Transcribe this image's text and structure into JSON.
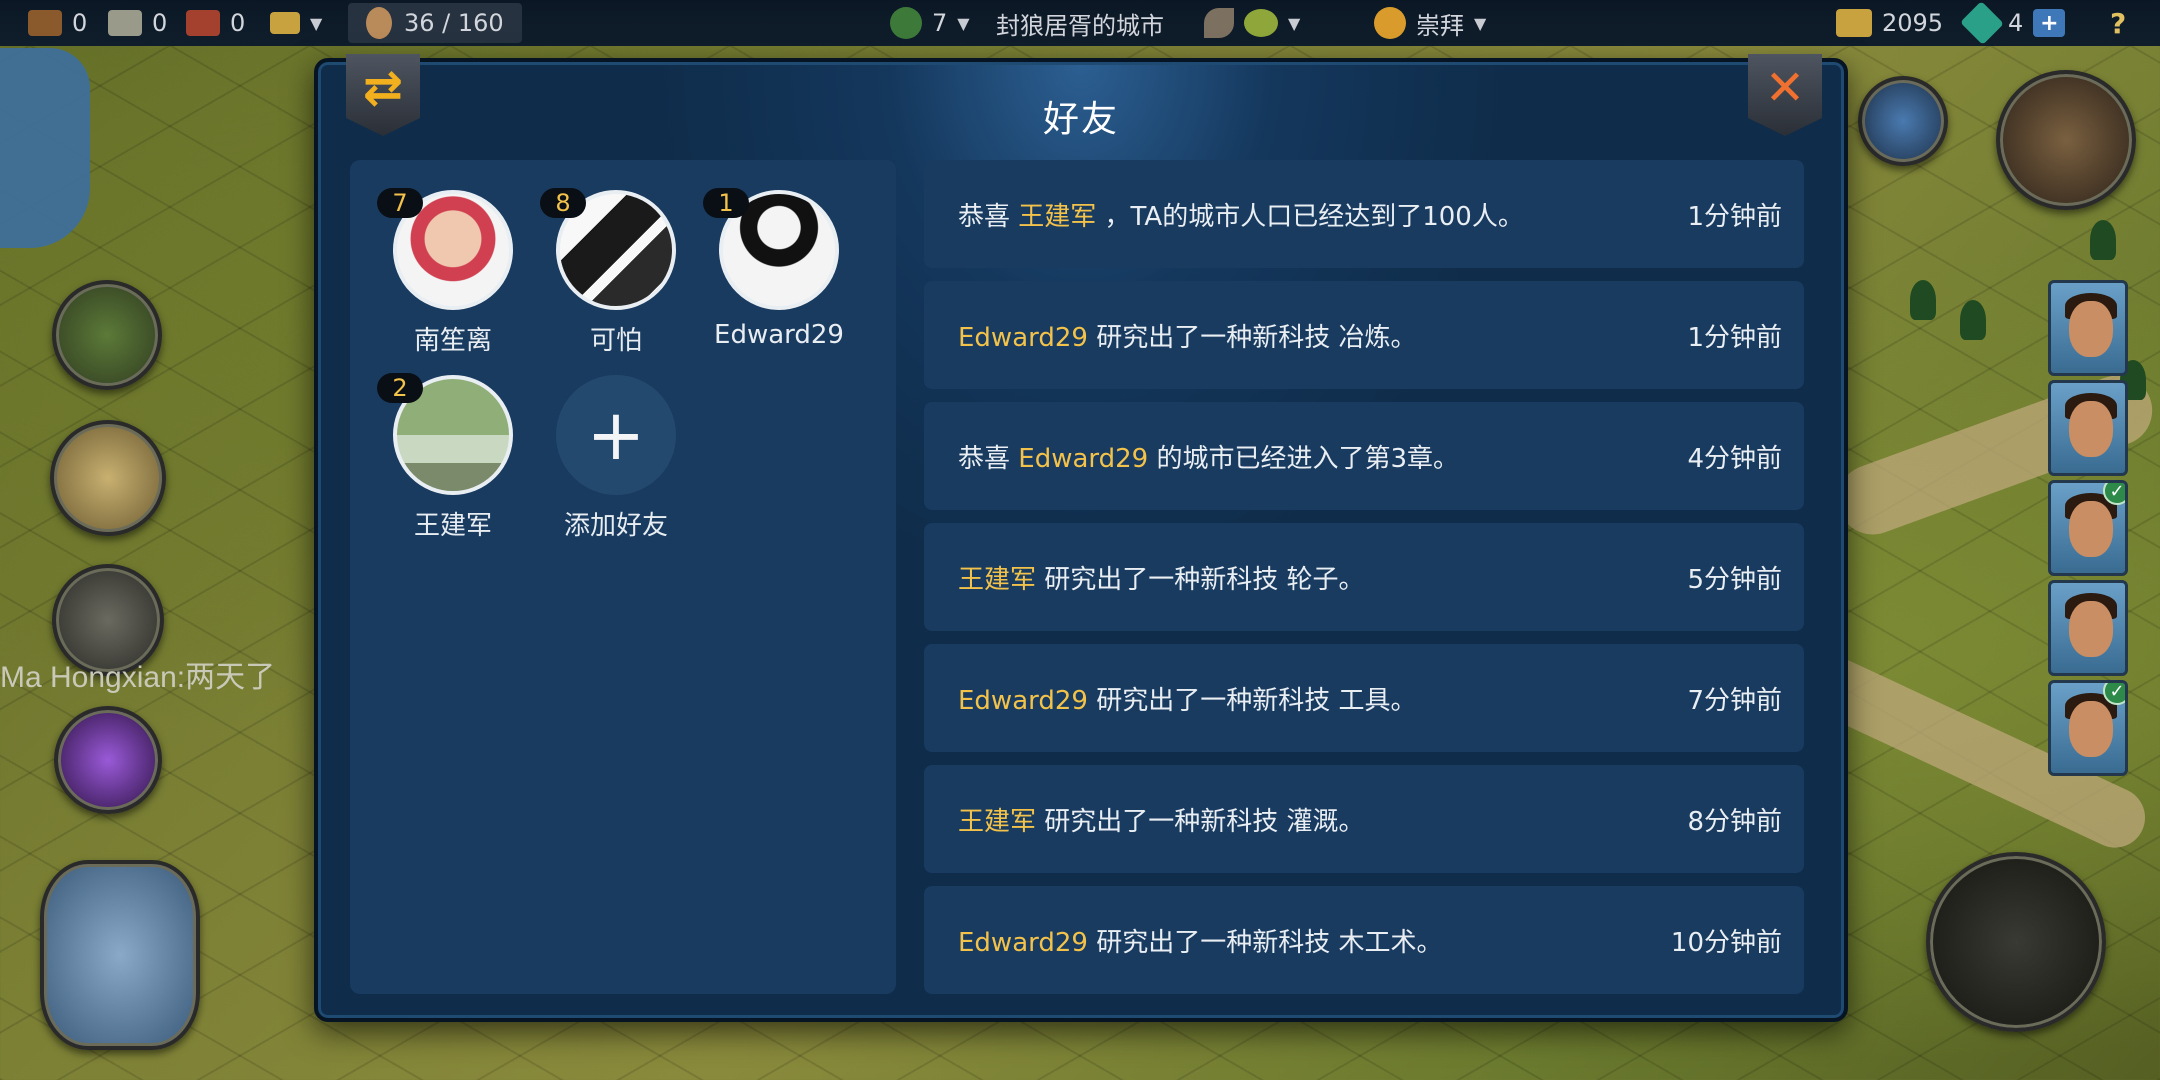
{
  "topbar": {
    "resources": [
      "0",
      "0",
      "0"
    ],
    "population": "36 / 160",
    "city_level": "7",
    "city_name": "封狼居胥的城市",
    "religion": "崇拜",
    "gold": "2095",
    "gems": "4",
    "gems_plus": "+",
    "help": "?"
  },
  "chat_overlay": "Ma Hongxian:两天了",
  "dialog": {
    "title": "好友",
    "refresh_icon": "refresh-icon",
    "close_icon": "close-icon"
  },
  "friends": [
    {
      "name": "南笙离",
      "level": "7"
    },
    {
      "name": "可怕",
      "level": "8"
    },
    {
      "name": "Edward29",
      "level": "1"
    },
    {
      "name": "王建军",
      "level": "2"
    }
  ],
  "add_friend": {
    "label": "添加好友",
    "icon": "+"
  },
  "feed": [
    {
      "pre": "恭喜 ",
      "name": "王建军",
      "post": " ，TA的城市人口已经达到了100人。",
      "time": "1分钟前"
    },
    {
      "pre": "",
      "name": "Edward29",
      "post": " 研究出了一种新科技 冶炼。",
      "time": "1分钟前"
    },
    {
      "pre": "恭喜 ",
      "name": "Edward29",
      "post": " 的城市已经进入了第3章。",
      "time": "4分钟前"
    },
    {
      "pre": "",
      "name": "王建军",
      "post": " 研究出了一种新科技 轮子。",
      "time": "5分钟前"
    },
    {
      "pre": "",
      "name": "Edward29",
      "post": " 研究出了一种新科技 工具。",
      "time": "7分钟前"
    },
    {
      "pre": "",
      "name": "王建军",
      "post": " 研究出了一种新科技 灌溉。",
      "time": "8分钟前"
    },
    {
      "pre": "",
      "name": "Edward29",
      "post": " 研究出了一种新科技 木工术。",
      "time": "10分钟前"
    }
  ],
  "colors": {
    "highlight": "#f2c24a",
    "panel": "#193b60",
    "dialog_bg": "#0f2c4a"
  }
}
